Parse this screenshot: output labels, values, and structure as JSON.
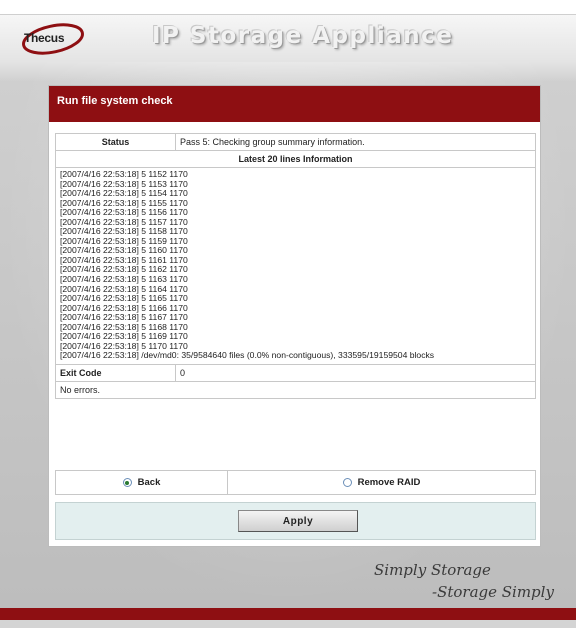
{
  "app": {
    "logo_text": "Thecus",
    "title": "IP Storage Appliance"
  },
  "panel": {
    "heading": "Run file system check",
    "status_label": "Status",
    "status_value": "Pass 5: Checking group summary information.",
    "log_header": "Latest 20 lines Information",
    "log_lines": [
      "[2007/4/16 22:53:18] 5 1152 1170",
      "[2007/4/16 22:53:18] 5 1153 1170",
      "[2007/4/16 22:53:18] 5 1154 1170",
      "[2007/4/16 22:53:18] 5 1155 1170",
      "[2007/4/16 22:53:18] 5 1156 1170",
      "[2007/4/16 22:53:18] 5 1157 1170",
      "[2007/4/16 22:53:18] 5 1158 1170",
      "[2007/4/16 22:53:18] 5 1159 1170",
      "[2007/4/16 22:53:18] 5 1160 1170",
      "[2007/4/16 22:53:18] 5 1161 1170",
      "[2007/4/16 22:53:18] 5 1162 1170",
      "[2007/4/16 22:53:18] 5 1163 1170",
      "[2007/4/16 22:53:18] 5 1164 1170",
      "[2007/4/16 22:53:18] 5 1165 1170",
      "[2007/4/16 22:53:18] 5 1166 1170",
      "[2007/4/16 22:53:18] 5 1167 1170",
      "[2007/4/16 22:53:18] 5 1168 1170",
      "[2007/4/16 22:53:18] 5 1169 1170",
      "[2007/4/16 22:53:18] 5 1170 1170",
      "[2007/4/16 22:53:18] /dev/md0: 35/9584640 files (0.0% non-contiguous), 333595/19159504 blocks"
    ],
    "exit_code_label": "Exit Code",
    "exit_code_value": "0",
    "result_text": "No errors."
  },
  "options": {
    "back_label": "Back",
    "back_selected": true,
    "remove_raid_label": "Remove RAID",
    "remove_raid_selected": false
  },
  "actions": {
    "apply_label": "Apply"
  },
  "footer": {
    "tagline_1": "Simply Storage",
    "tagline_2": "-Storage Simply"
  },
  "colors": {
    "accent_red": "#8e0f12",
    "apply_bar_bg": "#e3efef"
  }
}
